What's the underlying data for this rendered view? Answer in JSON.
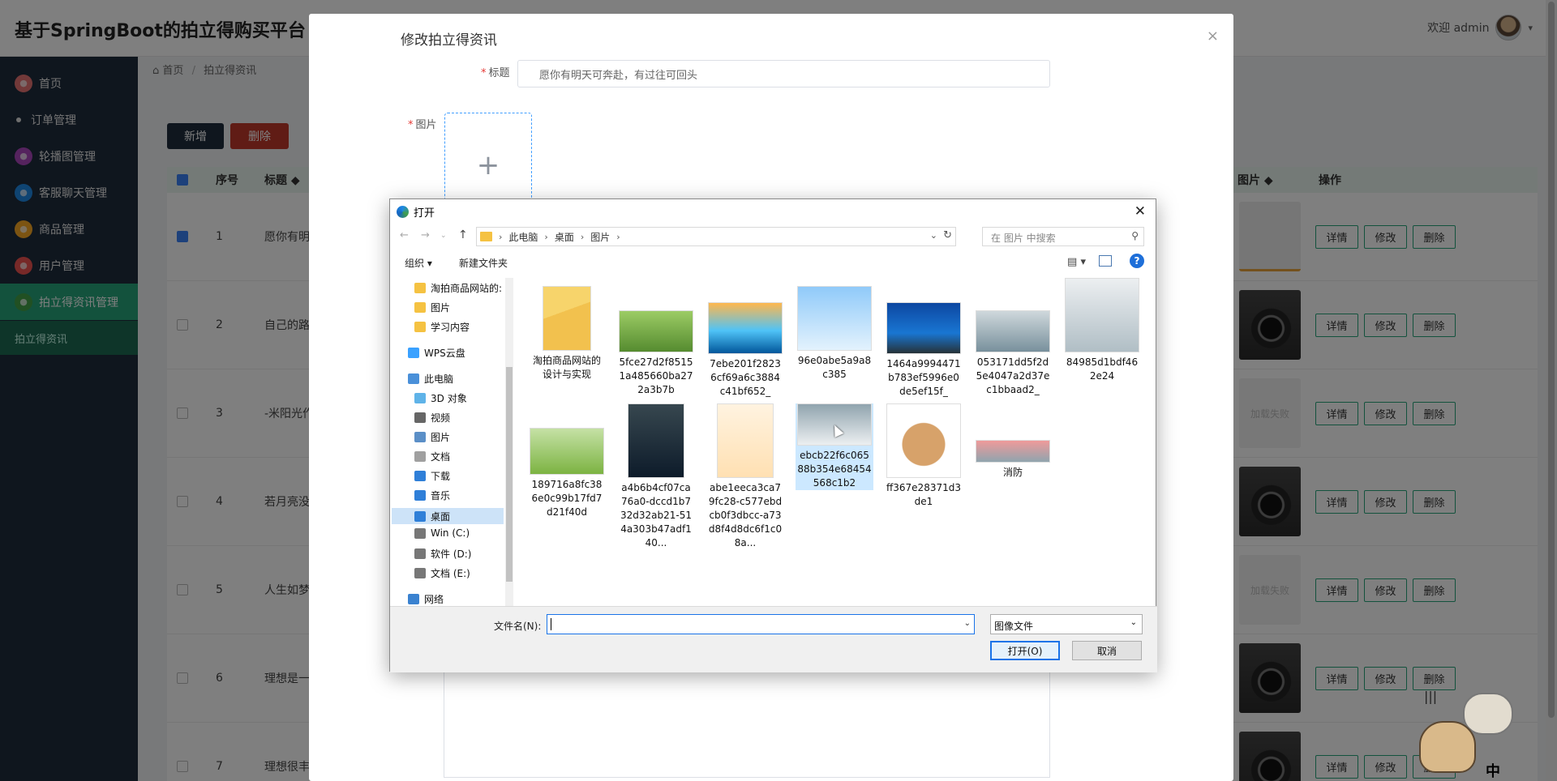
{
  "app": {
    "title": "基于SpringBoot的拍立得购买平台的设计与实现",
    "welcome": "欢迎 admin"
  },
  "sidebar": {
    "items": [
      {
        "label": "首页",
        "icon": "home-icon",
        "color": "#e57373"
      },
      {
        "label": "订单管理",
        "icon": "dot-icon",
        "color": "#dddddd"
      },
      {
        "label": "轮播图管理",
        "icon": "image-icon",
        "color": "#ab47bc"
      },
      {
        "label": "客服聊天管理",
        "icon": "chat-icon",
        "color": "#1e88e5"
      },
      {
        "label": "商品管理",
        "icon": "goods-icon",
        "color": "#f9a825"
      },
      {
        "label": "用户管理",
        "icon": "user-icon",
        "color": "#ef5350"
      },
      {
        "label": "拍立得资讯管理",
        "icon": "news-icon",
        "color": "#43a047"
      }
    ],
    "sub_item": "拍立得资讯"
  },
  "breadcrumb": {
    "home": "首页",
    "current": "拍立得资讯"
  },
  "toolbar": {
    "add_label": "新增",
    "delete_label": "删除"
  },
  "table": {
    "columns": {
      "no": "序号",
      "title": "标题 ◆",
      "image": "图片 ◆",
      "ops": "操作"
    },
    "rows": [
      {
        "no": "1",
        "title": "愿你有明",
        "checked": true,
        "image": "placeholder",
        "image_text": ""
      },
      {
        "no": "2",
        "title": "自己的路",
        "checked": false,
        "image": "camera",
        "image_text": ""
      },
      {
        "no": "3",
        "title": "-米阳光作",
        "checked": false,
        "image": "failed",
        "image_text": "加载失败"
      },
      {
        "no": "4",
        "title": "若月亮没",
        "checked": false,
        "image": "camera",
        "image_text": ""
      },
      {
        "no": "5",
        "title": "人生如梦",
        "checked": false,
        "image": "failed",
        "image_text": "加载失败"
      },
      {
        "no": "6",
        "title": "理想是一",
        "checked": false,
        "image": "camera",
        "image_text": ""
      },
      {
        "no": "7",
        "title": "理想很丰",
        "checked": false,
        "image": "camera",
        "image_text": ""
      }
    ],
    "op_labels": {
      "detail": "详情",
      "edit": "修改",
      "delete": "删除"
    }
  },
  "modal": {
    "title": "修改拍立得资讯",
    "close": "×",
    "title_label": "标题",
    "title_value": "愿你有明天可奔赴，有过往可回头",
    "image_label": "图片",
    "upload_plus": "+"
  },
  "dialog": {
    "title": "打开",
    "close": "✕",
    "path": [
      "此电脑",
      "桌面",
      "图片"
    ],
    "search_placeholder": "在 图片 中搜索",
    "organize": "组织 ▾",
    "new_folder": "新建文件夹",
    "help": "?",
    "nav": [
      {
        "label": "淘拍商品网站的:",
        "icon": "folder-icon",
        "indent": 1,
        "selected": false
      },
      {
        "label": "图片",
        "icon": "folder-icon",
        "indent": 1,
        "selected": false
      },
      {
        "label": "学习内容",
        "icon": "folder-icon",
        "indent": 1,
        "selected": false
      },
      {
        "label": "WPS云盘",
        "icon": "cloud-icon",
        "indent": 0,
        "selected": false
      },
      {
        "label": "此电脑",
        "icon": "pc-icon",
        "indent": 0,
        "selected": false
      },
      {
        "label": "3D 对象",
        "icon": "cube-icon",
        "indent": 1,
        "selected": false
      },
      {
        "label": "视频",
        "icon": "video-icon",
        "indent": 1,
        "selected": false
      },
      {
        "label": "图片",
        "icon": "picture-icon",
        "indent": 1,
        "selected": false
      },
      {
        "label": "文档",
        "icon": "document-icon",
        "indent": 1,
        "selected": false
      },
      {
        "label": "下载",
        "icon": "download-icon",
        "indent": 1,
        "selected": false
      },
      {
        "label": "音乐",
        "icon": "music-icon",
        "indent": 1,
        "selected": false
      },
      {
        "label": "桌面",
        "icon": "desktop-icon",
        "indent": 1,
        "selected": true
      },
      {
        "label": "Win (C:)",
        "icon": "drive-icon",
        "indent": 1,
        "selected": false
      },
      {
        "label": "软件 (D:)",
        "icon": "drive-icon",
        "indent": 1,
        "selected": false
      },
      {
        "label": "文档 (E:)",
        "icon": "drive-icon",
        "indent": 1,
        "selected": false
      },
      {
        "label": "网络",
        "icon": "network-icon",
        "indent": 0,
        "selected": false
      }
    ],
    "files": [
      {
        "name": "淘拍商品网站的设计与实现",
        "kind": "folder"
      },
      {
        "name": "5fce27d2f85151a485660ba272a3b7b",
        "kind": "cat"
      },
      {
        "name": "7ebe201f28236cf69a6c3884c41bf652_",
        "kind": "sunset"
      },
      {
        "name": "96e0abe5a9a8c385",
        "kind": "portrait-woman"
      },
      {
        "name": "1464a9994471b783ef5996e0de5ef15f_",
        "kind": "lake"
      },
      {
        "name": "053171dd5f2d5e4047a2d37ec1bbaad2_",
        "kind": "sea"
      },
      {
        "name": "84985d1bdf462e24",
        "kind": "portrait-woman2"
      },
      {
        "name": "189716a8fc386e0c99b17fd7d21f40d",
        "kind": "green"
      },
      {
        "name": "a4b6b4cf07ca76a0-dccd1b732d32ab21-514a303b47adf140...",
        "kind": "portrait-man"
      },
      {
        "name": "abe1eeca3ca79fc28-c577ebdcb0f3dbcc-a73d8f4d8dc6f1c08a...",
        "kind": "portrait-man2"
      },
      {
        "name": "ebcb22f6c06588b354e68454568c1b2",
        "kind": "bird"
      },
      {
        "name": "ff367e28371d3de1",
        "kind": "cartoon"
      },
      {
        "name": "消防",
        "kind": "fire"
      }
    ],
    "filename_label": "文件名(N):",
    "filename_value": "",
    "filetype": "图像文件",
    "open_label": "打开(O)",
    "cancel_label": "取消"
  },
  "pet_text": "中"
}
